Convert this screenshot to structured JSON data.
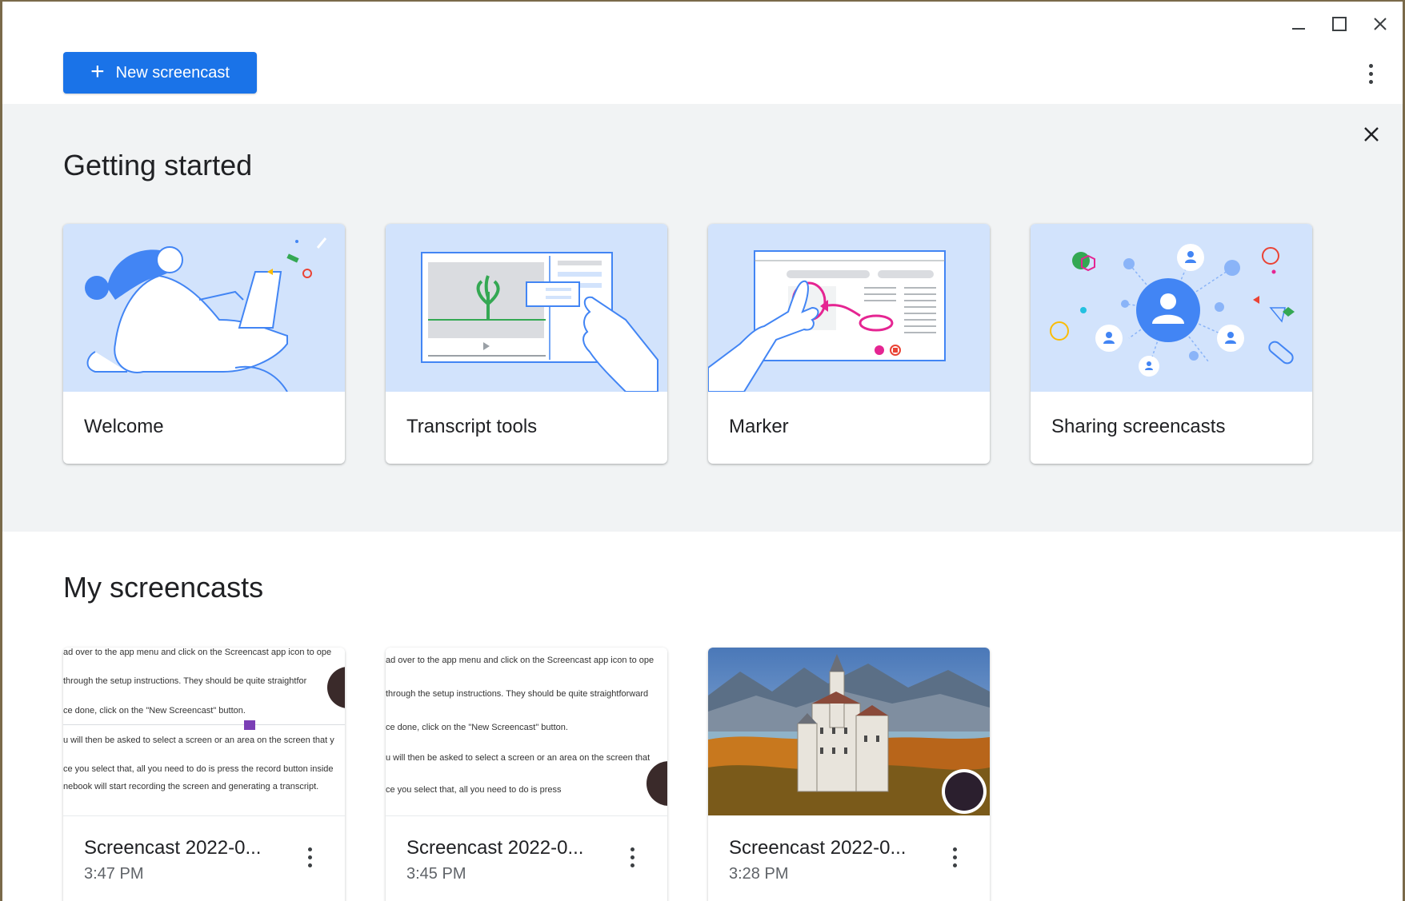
{
  "toolbar": {
    "new_button_label": "New screencast"
  },
  "getting_started": {
    "title": "Getting started",
    "cards": [
      {
        "label": "Welcome"
      },
      {
        "label": "Transcript tools"
      },
      {
        "label": "Marker"
      },
      {
        "label": "Sharing screencasts"
      }
    ]
  },
  "my_screencasts": {
    "title": "My screencasts",
    "items": [
      {
        "title": "Screencast 2022-0...",
        "time": "3:47 PM",
        "lines": [
          "ad over to the app menu and click on the Screencast app icon to ope",
          "through the setup instructions. They should be quite straightfor",
          "ce done, click on the \"New Screencast\" button.",
          "u will then be asked to select a screen or an area on the screen that y",
          "ce you select that, all you need to do is press the record button inside",
          "nebook will start recording the screen and generating a transcript."
        ]
      },
      {
        "title": "Screencast 2022-0...",
        "time": "3:45 PM",
        "lines": [
          "ad over to the app menu and click on the Screencast app icon to ope",
          "through the setup instructions. They should be quite straightforward",
          "ce done, click on the \"New Screencast\" button.",
          "u will then be asked to select a screen or an area on the screen that",
          "ce you select that, all you need to do is press"
        ]
      },
      {
        "title": "Screencast 2022-0...",
        "time": "3:28 PM"
      }
    ]
  },
  "colors": {
    "accent": "#1a73e8",
    "panel": "#f1f3f4",
    "illustration_bg": "#d2e3fc"
  }
}
